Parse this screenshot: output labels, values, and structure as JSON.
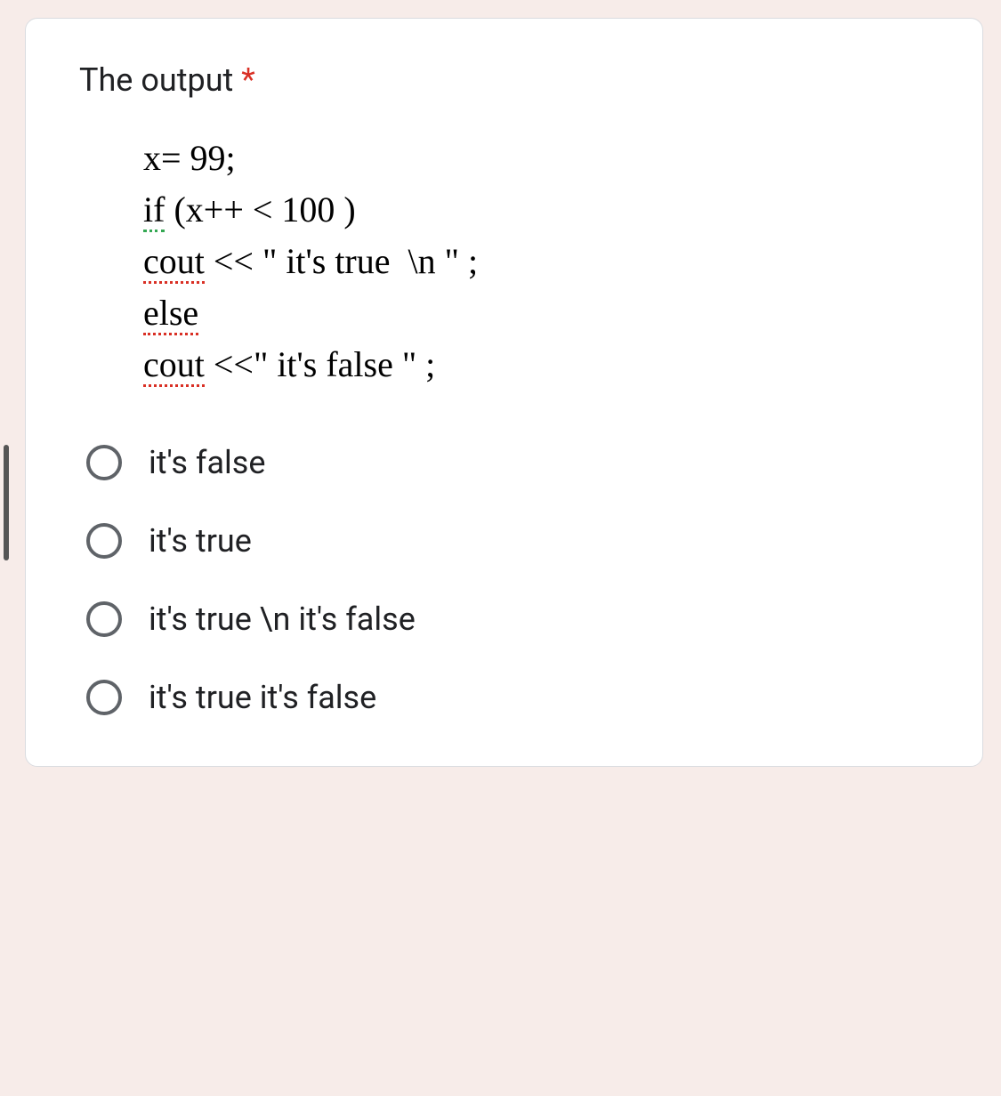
{
  "question": {
    "title": "The output",
    "required_marker": " *"
  },
  "code": {
    "line1_a": "x= 99;",
    "line2_if": "if",
    "line2_rest": " (x++ < 100 )",
    "line3_cout": "cout",
    "line3_rest": " << \" it's true  \\n \" ;",
    "line4_else": "else",
    "line5_cout": "cout",
    "line5_rest": " <<\" it's false \" ;"
  },
  "options": [
    {
      "label": "it's false"
    },
    {
      "label": "it's true"
    },
    {
      "label": "it's true \\n it's false"
    },
    {
      "label": "it's true it's false"
    }
  ]
}
